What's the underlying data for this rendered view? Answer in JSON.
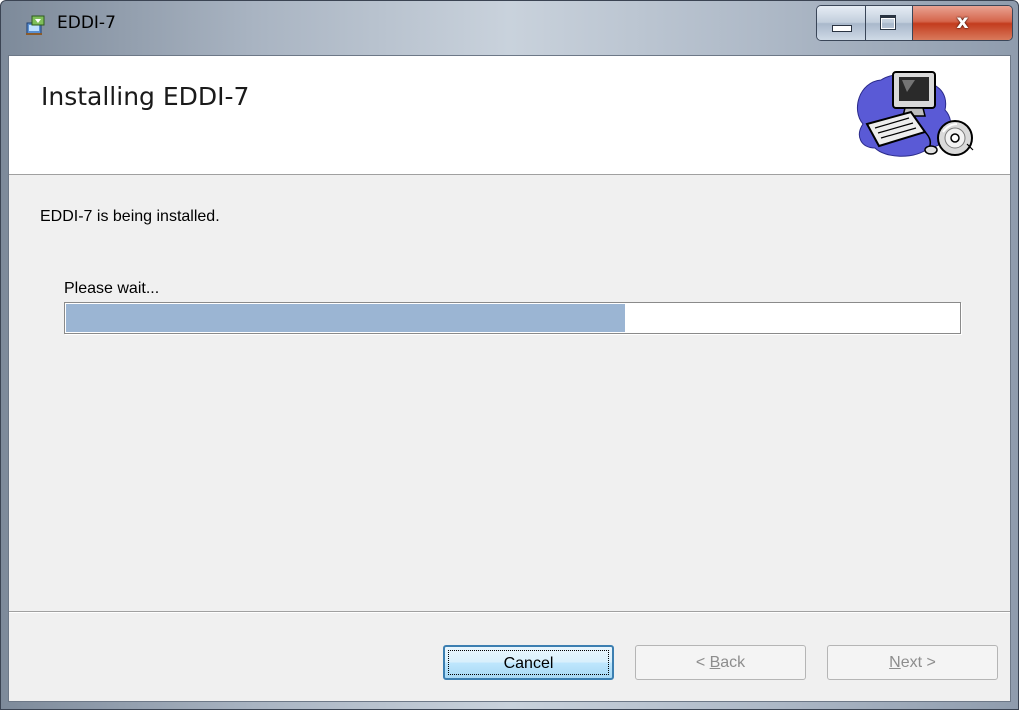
{
  "window": {
    "title": "EDDI-7",
    "title_icon": "installer-icon"
  },
  "caption_buttons": {
    "minimize": "minimize-icon",
    "maximize": "maximize-icon",
    "close": "close-icon"
  },
  "banner": {
    "heading": "Installing EDDI-7",
    "art": "computer-disc-icon"
  },
  "body": {
    "status": "EDDI-7 is being installed.",
    "wait_label": "Please wait...",
    "progress_fraction": 0.626
  },
  "buttons": {
    "cancel": "Cancel",
    "back_prefix": "< ",
    "back_mnemonic": "B",
    "back_rest": "ack",
    "next_mnemonic": "N",
    "next_rest": "ext >"
  },
  "colors": {
    "progress_fill": "#9bb5d3",
    "close_button": "#c33c1e"
  }
}
